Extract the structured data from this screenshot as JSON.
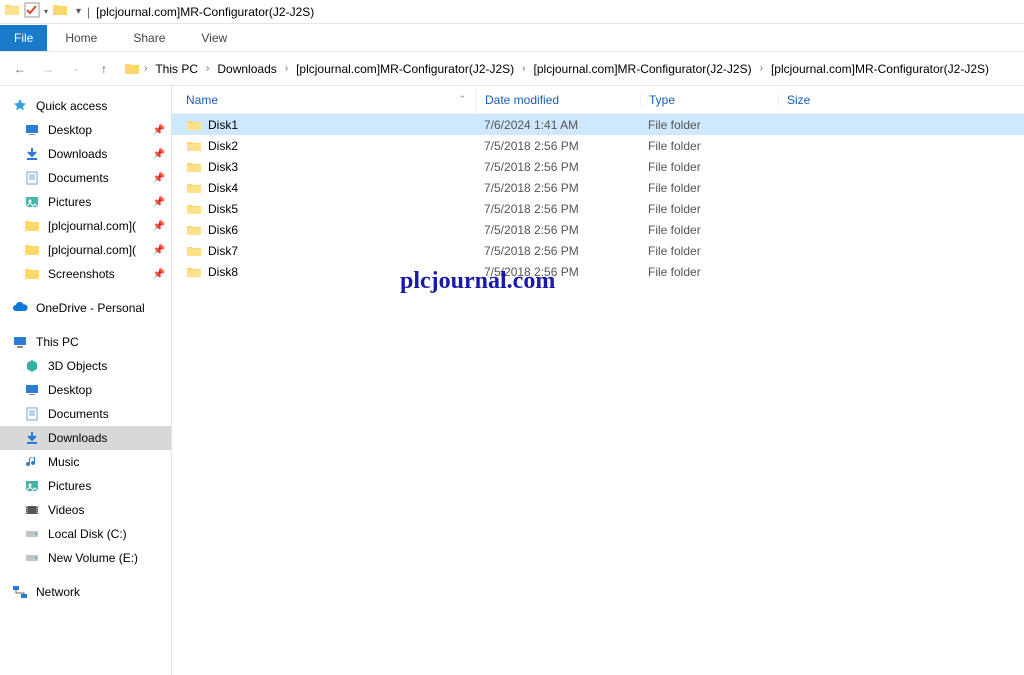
{
  "titlebar": {
    "title": "[plcjournal.com]MR-Configurator(J2-J2S)",
    "sep": "|"
  },
  "ribbon": {
    "file": "File",
    "tabs": [
      "Home",
      "Share",
      "View"
    ]
  },
  "breadcrumb": {
    "items": [
      "This PC",
      "Downloads",
      "[plcjournal.com]MR-Configurator(J2-J2S)",
      "[plcjournal.com]MR-Configurator(J2-J2S)",
      "[plcjournal.com]MR-Configurator(J2-J2S)"
    ]
  },
  "sidebar": {
    "quick_access": "Quick access",
    "qa_items": [
      {
        "label": "Desktop",
        "pin": true,
        "icon": "desktop"
      },
      {
        "label": "Downloads",
        "pin": true,
        "icon": "down"
      },
      {
        "label": "Documents",
        "pin": true,
        "icon": "doc"
      },
      {
        "label": "Pictures",
        "pin": true,
        "icon": "pic"
      },
      {
        "label": "[plcjournal.com](",
        "pin": true,
        "icon": "folder"
      },
      {
        "label": "[plcjournal.com](",
        "pin": true,
        "icon": "folder"
      },
      {
        "label": "Screenshots",
        "pin": true,
        "icon": "folder"
      }
    ],
    "onedrive": "OneDrive - Personal",
    "this_pc": "This PC",
    "pc_items": [
      {
        "label": "3D Objects",
        "icon": "3d"
      },
      {
        "label": "Desktop",
        "icon": "desktop"
      },
      {
        "label": "Documents",
        "icon": "doc"
      },
      {
        "label": "Downloads",
        "icon": "down",
        "selected": true
      },
      {
        "label": "Music",
        "icon": "music"
      },
      {
        "label": "Pictures",
        "icon": "pic"
      },
      {
        "label": "Videos",
        "icon": "video"
      },
      {
        "label": "Local Disk (C:)",
        "icon": "disk"
      },
      {
        "label": "New Volume (E:)",
        "icon": "disk"
      }
    ],
    "network": "Network"
  },
  "columns": {
    "name": "Name",
    "date": "Date modified",
    "type": "Type",
    "size": "Size"
  },
  "files": [
    {
      "name": "Disk1",
      "date": "7/6/2024 1:41 AM",
      "type": "File folder",
      "selected": true
    },
    {
      "name": "Disk2",
      "date": "7/5/2018 2:56 PM",
      "type": "File folder"
    },
    {
      "name": "Disk3",
      "date": "7/5/2018 2:56 PM",
      "type": "File folder"
    },
    {
      "name": "Disk4",
      "date": "7/5/2018 2:56 PM",
      "type": "File folder"
    },
    {
      "name": "Disk5",
      "date": "7/5/2018 2:56 PM",
      "type": "File folder"
    },
    {
      "name": "Disk6",
      "date": "7/5/2018 2:56 PM",
      "type": "File folder"
    },
    {
      "name": "Disk7",
      "date": "7/5/2018 2:56 PM",
      "type": "File folder"
    },
    {
      "name": "Disk8",
      "date": "7/5/2018 2:56 PM",
      "type": "File folder"
    }
  ],
  "watermark": "plcjournal.com"
}
